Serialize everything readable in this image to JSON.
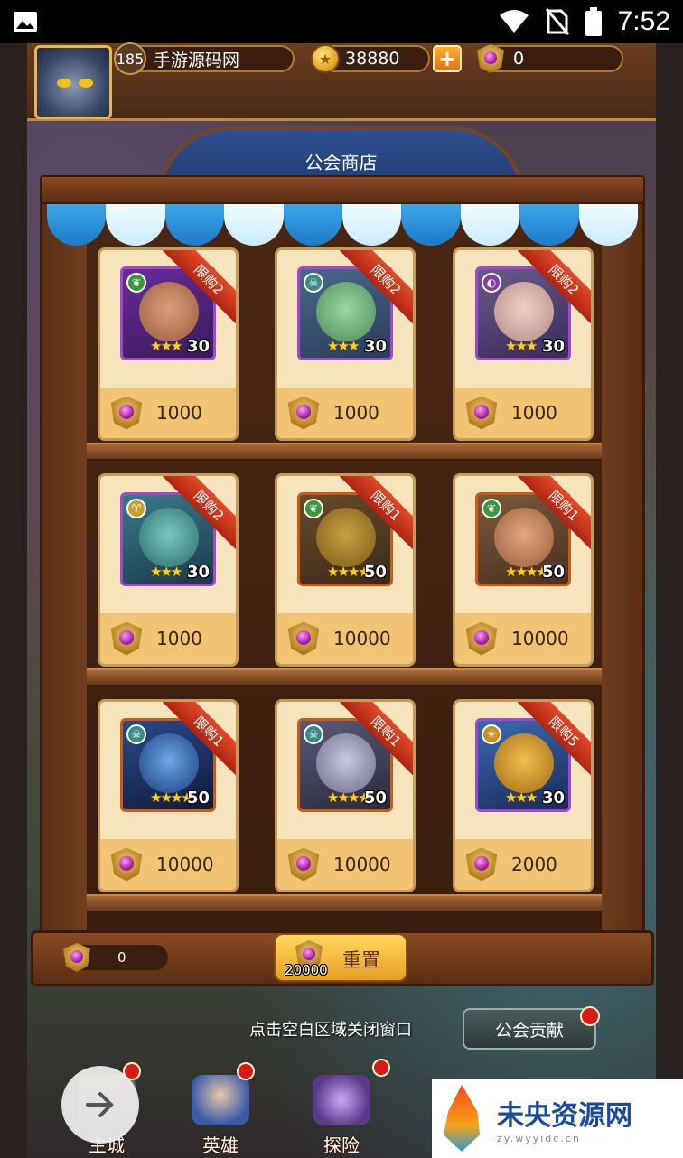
{
  "status_bar": {
    "time": "7:52"
  },
  "top_bar": {
    "player_level": "185",
    "player_name": "手游源码网",
    "coins": "38880",
    "gems": "0"
  },
  "shop": {
    "title": "公会商店",
    "items": [
      {
        "limit": "限购2",
        "stars": "★★★",
        "level": "30",
        "price": "1000"
      },
      {
        "limit": "限购2",
        "stars": "★★★",
        "level": "30",
        "price": "1000"
      },
      {
        "limit": "限购2",
        "stars": "★★★",
        "level": "30",
        "price": "1000"
      },
      {
        "limit": "限购2",
        "stars": "★★★",
        "level": "30",
        "price": "1000"
      },
      {
        "limit": "限购1",
        "stars": "★★★★",
        "level": "50",
        "price": "10000"
      },
      {
        "limit": "限购1",
        "stars": "★★★★",
        "level": "50",
        "price": "10000"
      },
      {
        "limit": "限购1",
        "stars": "★★★★",
        "level": "50",
        "price": "10000"
      },
      {
        "limit": "限购1",
        "stars": "★★★★",
        "level": "50",
        "price": "10000"
      },
      {
        "limit": "限购5",
        "stars": "★★★",
        "level": "30",
        "price": "2000"
      }
    ],
    "currency_balance": "0",
    "reset_label": "重置",
    "reset_cost": "20000"
  },
  "close_hint": "点击空白区域关闭窗口",
  "contribution_button": "公会贡献",
  "nav": {
    "main_city": "主城",
    "heroes": "英雄",
    "explore": "探险"
  },
  "watermark": {
    "title": "未央资源网",
    "subtitle": "zy.wyyidc.cn"
  },
  "colors": {
    "ribbon_red": "#e24a2a",
    "card_bg": "#f6e4bc",
    "wood": "#7a4322",
    "awning_blue": "#3aa8e8"
  }
}
